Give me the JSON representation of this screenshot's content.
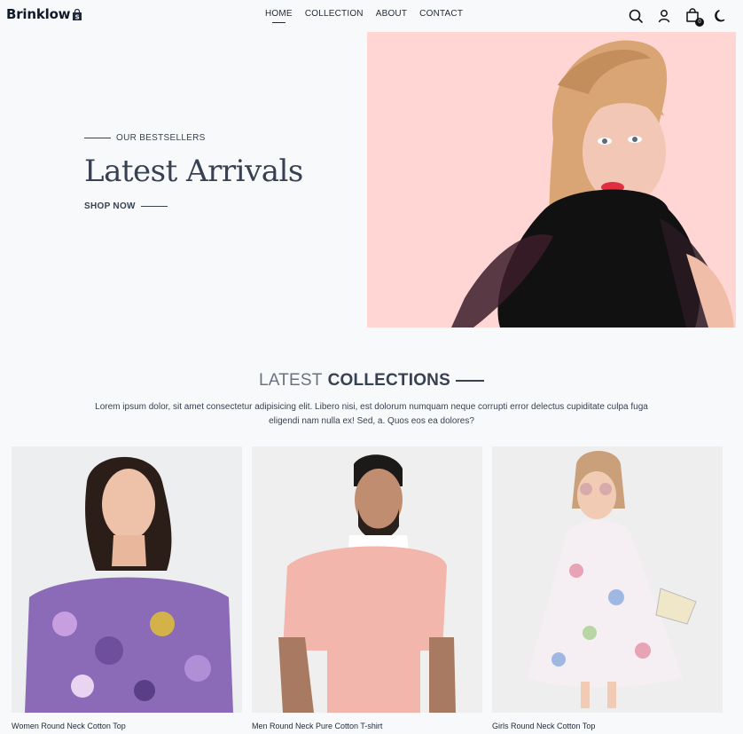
{
  "brand": {
    "name": "Brinklow"
  },
  "nav": [
    {
      "label": "HOME",
      "active": true
    },
    {
      "label": "COLLECTION",
      "active": false
    },
    {
      "label": "ABOUT",
      "active": false
    },
    {
      "label": "CONTACT",
      "active": false
    }
  ],
  "header_icons": [
    "search-icon",
    "user-icon",
    "cart-icon",
    "moon-icon"
  ],
  "cart": {
    "count": "0"
  },
  "hero": {
    "eyebrow": "OUR BESTSELLERS",
    "title": "Latest Arrivals",
    "cta": "SHOP NOW",
    "image_bg": "#ffd6d3"
  },
  "collections": {
    "title_light": "LATEST",
    "title_bold": "COLLECTIONS",
    "description": "Lorem ipsum dolor, sit amet consectetur adipisicing elit. Libero nisi, est dolorum numquam neque corrupti error delectus cupiditate culpa fuga eligendi nam nulla ex! Sed, a. Quos eos ea dolores?"
  },
  "products": [
    {
      "name": "Women Round Neck Cotton Top"
    },
    {
      "name": "Men Round Neck Pure Cotton T-shirt"
    },
    {
      "name": "Girls Round Neck Cotton Top"
    }
  ]
}
